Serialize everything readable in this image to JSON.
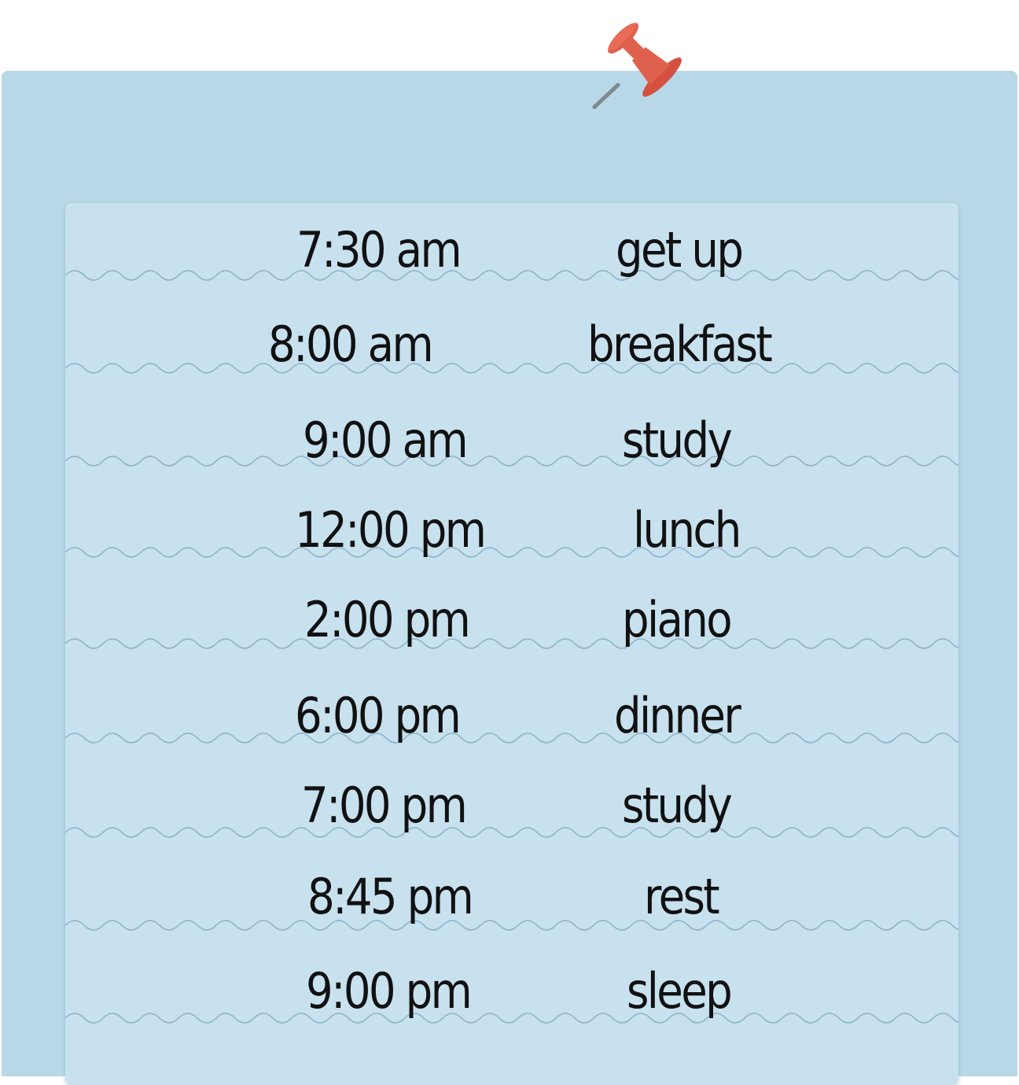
{
  "schedule": [
    {
      "time": "7:30 am",
      "activity": "get up"
    },
    {
      "time": "8:00 am",
      "activity": "breakfast"
    },
    {
      "time": "9:00 am",
      "activity": "study"
    },
    {
      "time": "12:00 pm",
      "activity": "lunch"
    },
    {
      "time": "2:00 pm",
      "activity": "piano"
    },
    {
      "time": "6:00 pm",
      "activity": "dinner"
    },
    {
      "time": "7:00 pm",
      "activity": "study"
    },
    {
      "time": "8:45 pm",
      "activity": "rest"
    },
    {
      "time": "9:00 pm",
      "activity": "sleep"
    }
  ],
  "icons": {
    "pin": "push-pin-icon"
  },
  "colors": {
    "board": "#b8d8e8",
    "sheet": "#c8e1ef",
    "pin": "#e0604e",
    "wave": "#8fb6c9"
  }
}
